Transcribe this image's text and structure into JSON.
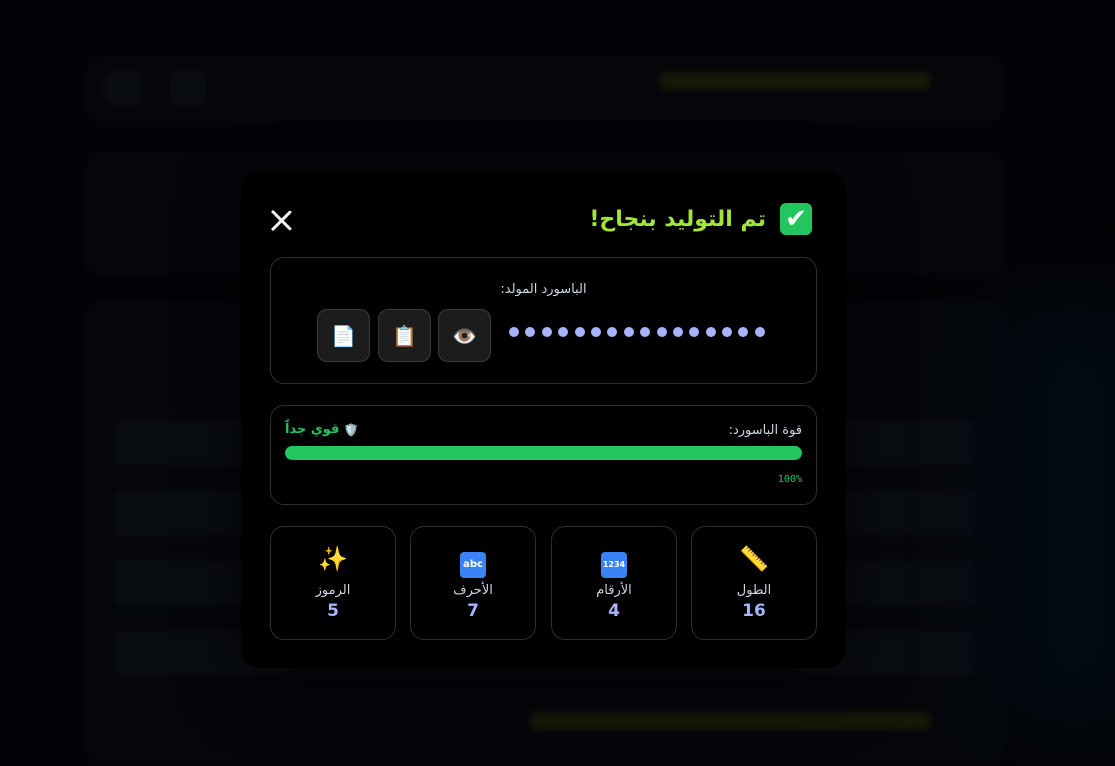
{
  "modal": {
    "title": "تم التوليد بنجاح!",
    "check_icon": "✔",
    "generated_label": "الباسورد المولد:",
    "password_mask_count": 16,
    "buttons": {
      "show_icon": "👁️",
      "copy_icon": "📋",
      "doc_icon": "📄"
    },
    "strength": {
      "label": "قوة الباسورد:",
      "value_text": "قوي جداً",
      "value_icon": "🛡️",
      "percent": 100,
      "percent_text": "100%",
      "color": "#22c55e"
    },
    "stats": [
      {
        "icon": "📏",
        "label": "الطول",
        "value": "16"
      },
      {
        "icon": "1234",
        "label": "الأرقام",
        "value": "4"
      },
      {
        "icon": "abc",
        "label": "الأحرف",
        "value": "7"
      },
      {
        "icon": "✨",
        "label": "الرموز",
        "value": "5"
      }
    ]
  }
}
